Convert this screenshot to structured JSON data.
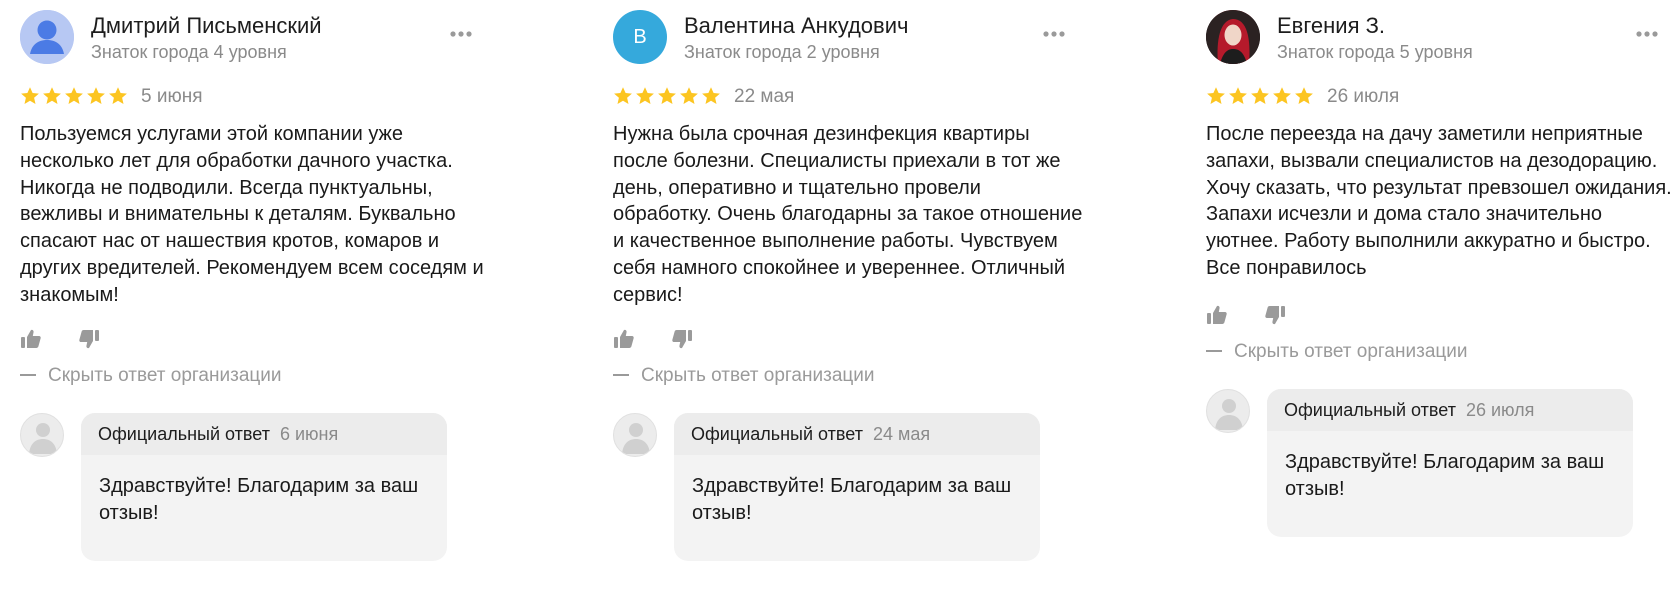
{
  "colors": {
    "star": "#fcc521",
    "muted_text": "#8a8a8a",
    "answer_bg": "#f3f3f3",
    "letter_avatar": "#35a9dc"
  },
  "reviews": [
    {
      "author": "Дмитрий Письменский",
      "level": "Знаток города 4 уровня",
      "avatar_icon": "user-silhouette-icon",
      "rating": 5,
      "date": "5 июня",
      "text": "Пользуемся услугами этой компании уже несколько лет для обработки дачного участка. Никогда не подводили. Всегда пунктуальны, вежливы и внимательны к деталям. Буквально спасают нас от нашествия кротов, комаров и других вредителей. Рекомендуем всем соседям и знакомым!",
      "hide_answer_label": "Скрыть ответ организации",
      "answer": {
        "label": "Официальный ответ",
        "date": "6 июня",
        "text": "Здравствуйте! Благодарим за ваш отзыв!"
      }
    },
    {
      "author": "Валентина Анкудович",
      "level": "Знаток города 2 уровня",
      "avatar_letter": "В",
      "rating": 5,
      "date": "22 мая",
      "text": "Нужна была срочная дезинфекция квартиры после болезни. Специалисты приехали в тот же день, оперативно и тщательно провели обработку. Очень благодарны за такое отношение и качественное выполнение работы. Чувствуем себя намного спокойнее и увереннее. Отличный сервис!",
      "hide_answer_label": "Скрыть ответ организации",
      "answer": {
        "label": "Официальный ответ",
        "date": "24 мая",
        "text": "Здравствуйте! Благодарим за ваш отзыв!"
      }
    },
    {
      "author": "Евгения З.",
      "level": "Знаток города 5 уровня",
      "avatar_icon": "user-photo-icon",
      "rating": 5,
      "date": "26 июля",
      "text": "После переезда на дачу заметили неприятные запахи, вызвали специалистов на дезодорацию. Хочу сказать, что результат превзошел ожидания. Запахи исчезли и дома стало значительно уютнее. Работу выполнили аккуратно и быстро. Все понравилось",
      "hide_answer_label": "Скрыть ответ организации",
      "answer": {
        "label": "Официальный ответ",
        "date": "26 июля",
        "text": "Здравствуйте! Благодарим за ваш отзыв!"
      }
    }
  ]
}
